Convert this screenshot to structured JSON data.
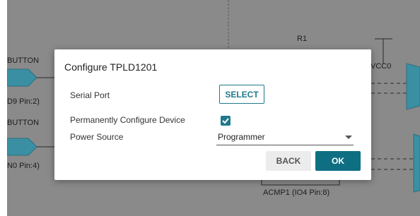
{
  "background": {
    "labels": {
      "button_top": "BUTTON",
      "pin_top": "D9 Pin:2)",
      "button_bottom": "BUTTON",
      "pin_bottom": "N0 Pin:4)",
      "r1": "R1",
      "vcc0": "VCC0",
      "acmp1": "ACMP1 (IO4 Pin:8)"
    }
  },
  "dialog": {
    "title": "Configure TPLD1201",
    "serial_port_label": "Serial Port",
    "select_label": "SELECT",
    "permanent_label": "Permanently Configure Device",
    "permanent_checked": true,
    "power_source_label": "Power Source",
    "power_source_value": "Programmer",
    "back_label": "BACK",
    "ok_label": "OK"
  },
  "colors": {
    "accent": "#0f6f82",
    "overlay": "#8a8a8a"
  }
}
